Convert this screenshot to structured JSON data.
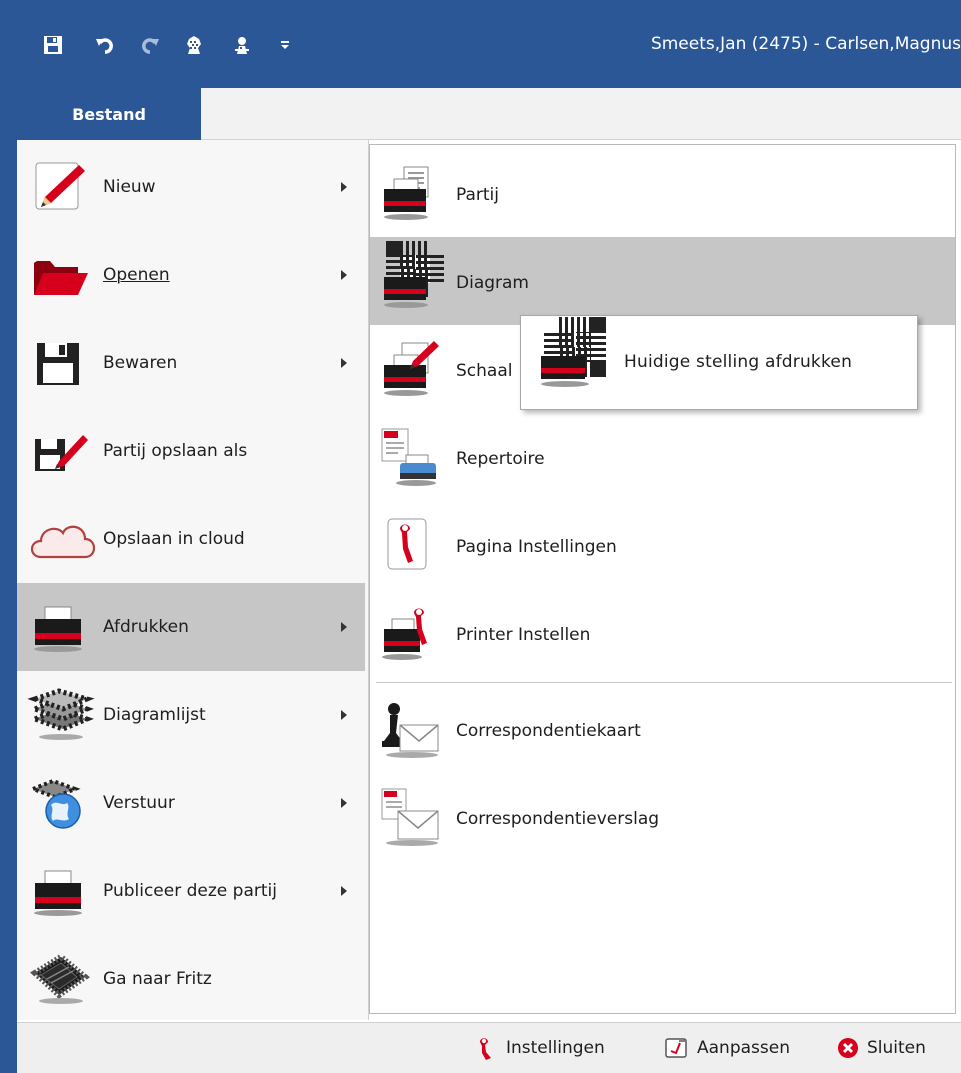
{
  "window": {
    "title": "Smeets,Jan (2475) - Carlsen,Magnus"
  },
  "quick_access": [
    {
      "name": "save-icon"
    },
    {
      "name": "undo-icon"
    },
    {
      "name": "redo-icon"
    },
    {
      "name": "engine-icon"
    },
    {
      "name": "engine-settings-icon"
    },
    {
      "name": "customize-dropdown-icon"
    }
  ],
  "ribbon": {
    "file_tab": "Bestand"
  },
  "left_menu": {
    "items": [
      {
        "label": "Nieuw",
        "icon": "new-pencil-icon",
        "submenu": true,
        "active": false
      },
      {
        "label": "Openen",
        "icon": "folder-open-icon",
        "submenu": true,
        "active": false
      },
      {
        "label": "Bewaren",
        "icon": "floppy-disk-icon",
        "submenu": true,
        "active": false
      },
      {
        "label": "Partij opslaan als",
        "icon": "save-as-icon",
        "submenu": false,
        "active": false
      },
      {
        "label": "Opslaan in cloud",
        "icon": "cloud-icon",
        "submenu": false,
        "active": false
      },
      {
        "label": "Afdrukken",
        "icon": "printer-icon",
        "submenu": true,
        "active": true
      },
      {
        "label": "Diagramlijst",
        "icon": "diagram-list-icon",
        "submenu": true,
        "active": false
      },
      {
        "label": "Verstuur",
        "icon": "globe-send-icon",
        "submenu": true,
        "active": false
      },
      {
        "label": "Publiceer deze partij",
        "icon": "publish-printer-icon",
        "submenu": true,
        "active": false
      },
      {
        "label": "Ga naar Fritz",
        "icon": "chip-icon",
        "submenu": false,
        "active": false
      }
    ]
  },
  "print_submenu": {
    "items": [
      {
        "label": "Partij",
        "icon": "print-game-icon",
        "active": false
      },
      {
        "label": "Diagram",
        "icon": "print-diagram-icon",
        "active": true
      },
      {
        "label": "Schaal",
        "icon": "print-scoresheet-icon",
        "active": false
      },
      {
        "label": "Repertoire",
        "icon": "print-repertoire-icon",
        "active": false
      },
      {
        "label": "Pagina Instellingen",
        "icon": "page-setup-icon",
        "active": false
      },
      {
        "label": "Printer Instellen",
        "icon": "printer-setup-icon",
        "active": false
      },
      {
        "label": "Correspondentiekaart",
        "icon": "correspondence-card-icon",
        "active": false
      },
      {
        "label": "Correspondentieverslag",
        "icon": "correspondence-report-icon",
        "active": false
      }
    ]
  },
  "diagram_flyout": {
    "label": "Huidige stelling afdrukken",
    "icon": "print-current-position-icon"
  },
  "bottom_bar": {
    "instellingen": "Instellingen",
    "aanpassen": "Aanpassen",
    "sluiten": "Sluiten"
  },
  "colors": {
    "accent": "#2b5797",
    "menu_bg": "#f7f7f7",
    "active_row": "#c6c6c6",
    "printer_red": "#d6001c"
  }
}
